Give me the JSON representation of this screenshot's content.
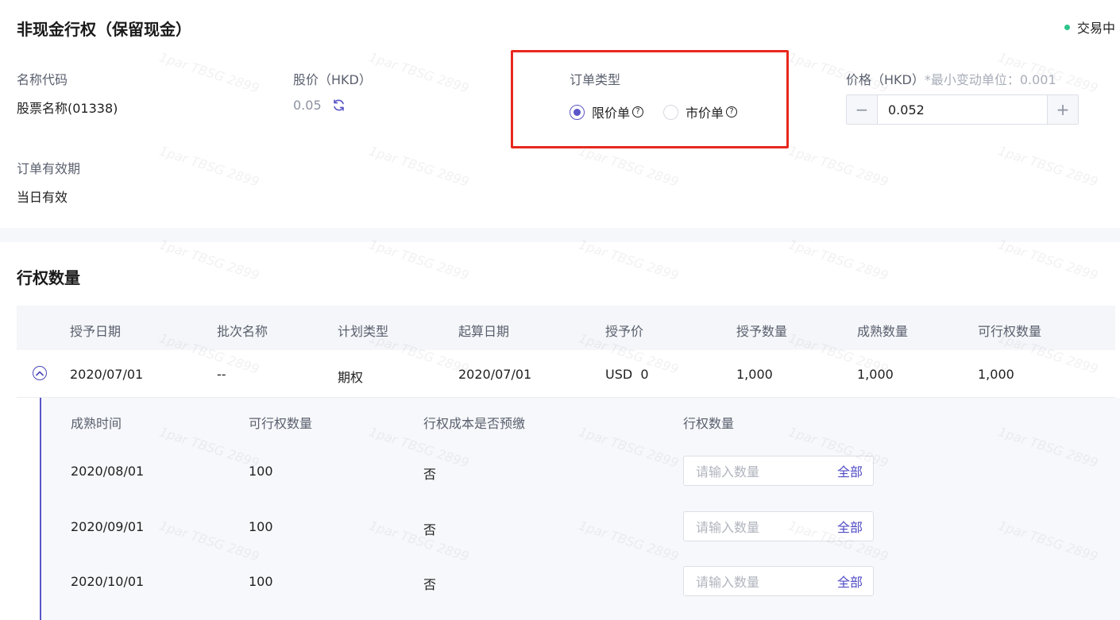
{
  "header": {
    "title": "非现金行权（保留现金）",
    "status": "交易中"
  },
  "order": {
    "name_code_label": "名称代码",
    "name_code_value": "股票名称(01338)",
    "stock_price_label": "股价（HKD）",
    "stock_price_value": "0.05",
    "order_type_label": "订单类型",
    "order_type_options": [
      {
        "label": "限价单",
        "selected": true
      },
      {
        "label": "市价单",
        "selected": false
      }
    ],
    "price_label": "价格（HKD）",
    "price_hint": "*最小变动单位：0.001",
    "price_value": "0.052",
    "validity_label": "订单有效期",
    "validity_value": "当日有效"
  },
  "exercise": {
    "section_title": "行权数量",
    "columns": [
      "授予日期",
      "批次名称",
      "计划类型",
      "起算日期",
      "授予价",
      "授予数量",
      "成熟数量",
      "可行权数量"
    ],
    "rows": [
      {
        "grant_date": "2020/07/01",
        "batch_name": "--",
        "plan_type": "期权",
        "start_date": "2020/07/01",
        "grant_price": "USD  0",
        "grant_qty": "1,000",
        "vested_qty": "1,000",
        "exercisable_qty": "1,000"
      }
    ],
    "sub_columns": [
      "成熟时间",
      "可行权数量",
      "行权成本是否预缴",
      "行权数量"
    ],
    "sub_rows": [
      {
        "vest_time": "2020/08/01",
        "exercisable": "100",
        "prepaid": "否"
      },
      {
        "vest_time": "2020/09/01",
        "exercisable": "100",
        "prepaid": "否"
      },
      {
        "vest_time": "2020/10/01",
        "exercisable": "100",
        "prepaid": "否"
      }
    ],
    "qty_placeholder": "请输入数量",
    "qty_all_label": "全部"
  },
  "colors": {
    "accent": "#5a55c8",
    "status_dot": "#2bc48a",
    "highlight_border": "#e8281e"
  },
  "watermark_text": "1par TBSG 2899"
}
